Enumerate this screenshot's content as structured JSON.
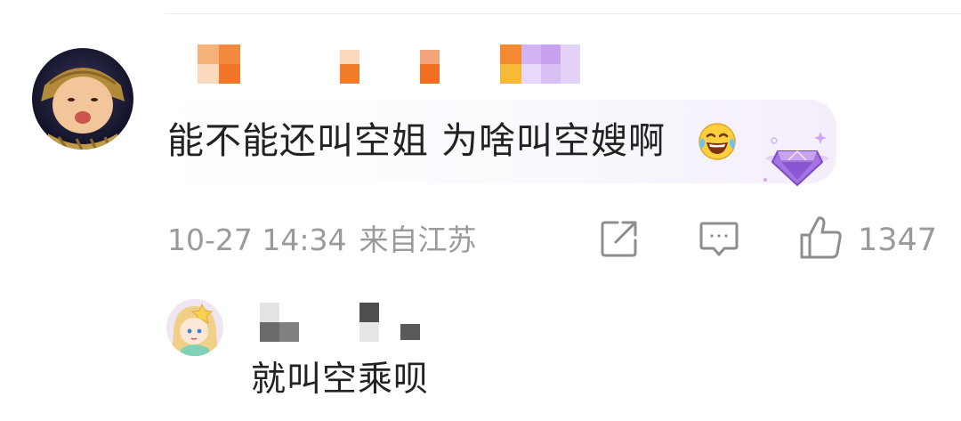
{
  "comment": {
    "text": "能不能还叫空姐 为啥叫空嫂啊",
    "emoji_icon": "laughing-tears-emoji-icon",
    "badge_icon": "purple-gem-fan-badge-icon",
    "timestamp": "10-27 14:34",
    "location": "来自江苏",
    "likes": "1347",
    "actions": [
      "share-icon",
      "comment-icon",
      "like-icon"
    ]
  },
  "reply": {
    "text": "就叫空乘呗"
  },
  "colors": {
    "meta_gray": "#9a9a9a",
    "text_dark": "#222222",
    "name_blur_orange": "#f08a40",
    "name_blur_purple": "#c9a6f0",
    "reply_name_blur": "#6e6e6e",
    "badge_purple": "#9b6bd8"
  }
}
